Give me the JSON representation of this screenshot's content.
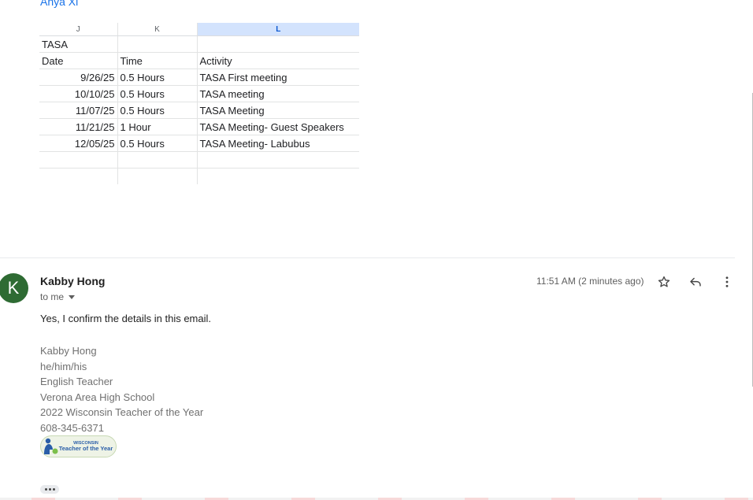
{
  "previous_message": {
    "sender": "Anya Xi"
  },
  "spreadsheet": {
    "column_headers": [
      "J",
      "K",
      "L"
    ],
    "selected_column": "L",
    "title": "TASA",
    "table_headers": [
      "Date",
      "Time",
      "Activity"
    ],
    "rows": [
      [
        "9/26/25",
        "0.5 Hours",
        "TASA First meeting"
      ],
      [
        "10/10/25",
        "0.5 Hours",
        "TASA meeting"
      ],
      [
        "11/07/25",
        "0.5 Hours",
        "TASA Meeting"
      ],
      [
        "11/21/25",
        "1 Hour",
        "TASA Meeting- Guest Speakers"
      ],
      [
        "12/05/25",
        "0.5 Hours",
        "TASA Meeting- Labubus"
      ]
    ]
  },
  "message": {
    "avatar_letter": "K",
    "avatar_color": "#2e6b33",
    "sender": "Kabby Hong",
    "recipient": "to me",
    "timestamp": "11:51 AM (2 minutes ago)",
    "body": "Yes, I confirm the details in this email.",
    "signature": [
      "Kabby Hong",
      "he/him/his",
      "English Teacher",
      "Verona Area High School",
      "2022 Wisconsin Teacher of the Year",
      "608-345-6371"
    ],
    "logo": {
      "line1": "WISCONSIN",
      "line2": "Teacher of the Year"
    },
    "actions": [
      "star-icon",
      "reply-icon",
      "more-vert-icon"
    ]
  }
}
